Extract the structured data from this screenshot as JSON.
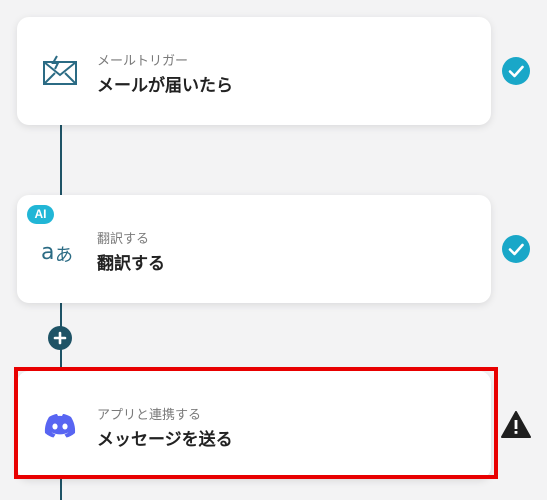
{
  "steps": [
    {
      "subtitle": "メールトリガー",
      "title": "メールが届いたら",
      "icon": "mail-trigger-icon",
      "status": "complete"
    },
    {
      "subtitle": "翻訳する",
      "title": "翻訳する",
      "icon": "translate-icon",
      "badge": "AI",
      "status": "complete"
    },
    {
      "subtitle": "アプリと連携する",
      "title": "メッセージを送る",
      "icon": "discord-icon",
      "status": "warning"
    }
  ],
  "colors": {
    "connector": "#1e5366",
    "check": "#19a7c8",
    "ai_badge": "#21b6d6",
    "highlight": "#e80000",
    "discord": "#5865f2"
  }
}
